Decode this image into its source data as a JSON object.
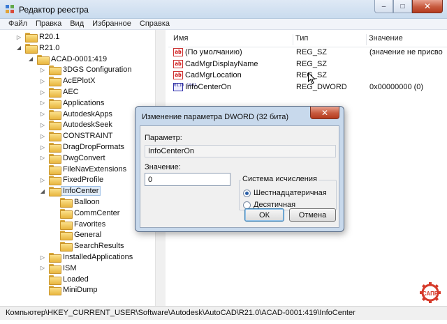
{
  "window": {
    "title": "Редактор реестра",
    "buttons": {
      "minimize": "–",
      "maximize": "□",
      "close": "✕"
    }
  },
  "menu": [
    "Файл",
    "Правка",
    "Вид",
    "Избранное",
    "Справка"
  ],
  "tree": [
    {
      "label": "R20.1",
      "depth": 1,
      "toggle": "▷"
    },
    {
      "label": "R21.0",
      "depth": 1,
      "toggle": "◢"
    },
    {
      "label": "ACAD-0001:419",
      "depth": 2,
      "toggle": "◢"
    },
    {
      "label": "3DGS Configuration",
      "depth": 3,
      "toggle": "▷"
    },
    {
      "label": "AcEPlotX",
      "depth": 3,
      "toggle": "▷"
    },
    {
      "label": "AEC",
      "depth": 3,
      "toggle": "▷"
    },
    {
      "label": "Applications",
      "depth": 3,
      "toggle": "▷"
    },
    {
      "label": "AutodeskApps",
      "depth": 3,
      "toggle": "▷"
    },
    {
      "label": "AutodeskSeek",
      "depth": 3,
      "toggle": "▷"
    },
    {
      "label": "CONSTRAINT",
      "depth": 3,
      "toggle": "▷"
    },
    {
      "label": "DragDropFormats",
      "depth": 3,
      "toggle": "▷"
    },
    {
      "label": "DwgConvert",
      "depth": 3,
      "toggle": "▷"
    },
    {
      "label": "FileNavExtensions",
      "depth": 3,
      "toggle": ""
    },
    {
      "label": "FixedProfile",
      "depth": 3,
      "toggle": "▷"
    },
    {
      "label": "InfoCenter",
      "depth": 3,
      "toggle": "◢",
      "selected": true
    },
    {
      "label": "Balloon",
      "depth": 4,
      "toggle": ""
    },
    {
      "label": "CommCenter",
      "depth": 4,
      "toggle": ""
    },
    {
      "label": "Favorites",
      "depth": 4,
      "toggle": ""
    },
    {
      "label": "General",
      "depth": 4,
      "toggle": ""
    },
    {
      "label": "SearchResults",
      "depth": 4,
      "toggle": ""
    },
    {
      "label": "InstalledApplications",
      "depth": 3,
      "toggle": "▷"
    },
    {
      "label": "ISM",
      "depth": 3,
      "toggle": "▷"
    },
    {
      "label": "Loaded",
      "depth": 3,
      "toggle": ""
    },
    {
      "label": "MiniDump",
      "depth": 3,
      "toggle": ""
    }
  ],
  "list": {
    "columns": {
      "name": "Имя",
      "type": "Тип",
      "value": "Значение"
    },
    "rows": [
      {
        "icon": "string",
        "name": "(По умолчанию)",
        "type": "REG_SZ",
        "value": "(значение не присво"
      },
      {
        "icon": "string",
        "name": "CadMgrDisplayName",
        "type": "REG_SZ",
        "value": ""
      },
      {
        "icon": "string",
        "name": "CadMgrLocation",
        "type": "REG_SZ",
        "value": ""
      },
      {
        "icon": "binary",
        "name": "InfoCenterOn",
        "type": "REG_DWORD",
        "value": "0x00000000 (0)"
      }
    ]
  },
  "status": "Компьютер\\HKEY_CURRENT_USER\\Software\\Autodesk\\AutoCAD\\R21.0\\ACAD-0001:419\\InfoCenter",
  "dialog": {
    "title": "Изменение параметра DWORD (32 бита)",
    "close": "✕",
    "param_label": "Параметр:",
    "param_value": "InfoCenterOn",
    "value_label": "Значение:",
    "value": "0",
    "base_group": "Система исчисления",
    "radio_hex": "Шестнадцатеричная",
    "radio_dec": "Десятичная",
    "selected_base": "hex",
    "ok": "ОК",
    "cancel": "Отмена"
  },
  "logo": {
    "text": "САПР",
    "color": "#d63a2a"
  },
  "icons": {
    "app": "registry-icon",
    "folder": "folder-icon",
    "string_value": "ab-string-icon",
    "dword_value": "binary-value-icon"
  }
}
